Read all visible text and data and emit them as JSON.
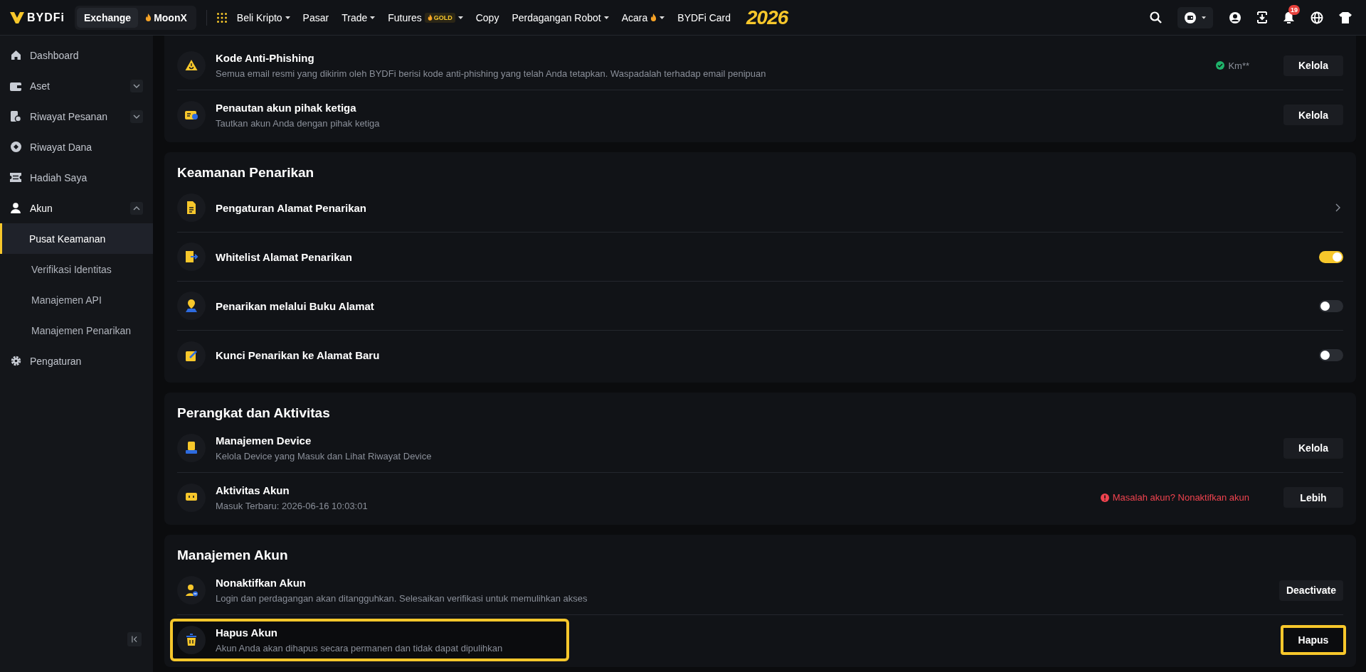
{
  "header": {
    "logo": "BYDFi",
    "modes": [
      {
        "label": "Exchange",
        "selected": true
      },
      {
        "label": "MoonX",
        "selected": false,
        "flame": true
      }
    ],
    "menu": [
      {
        "label": "Beli Kripto",
        "dropdown": true
      },
      {
        "label": "Pasar",
        "dropdown": false
      },
      {
        "label": "Trade",
        "dropdown": true
      },
      {
        "label": "Futures",
        "dropdown": true,
        "badge": "GOLD"
      },
      {
        "label": "Copy",
        "dropdown": false
      },
      {
        "label": "Perdagangan Robot",
        "dropdown": true
      },
      {
        "label": "Acara",
        "dropdown": true,
        "flame": true
      },
      {
        "label": "BYDFi Card",
        "dropdown": false
      }
    ],
    "promo": "2026",
    "notifications": "19"
  },
  "sidebar": {
    "items": [
      {
        "label": "Dashboard",
        "selected": false
      },
      {
        "label": "Aset",
        "selected": false,
        "expanded": false
      },
      {
        "label": "Riwayat Pesanan",
        "selected": false,
        "expanded": false
      },
      {
        "label": "Riwayat Dana",
        "selected": false
      },
      {
        "label": "Hadiah Saya",
        "selected": false
      },
      {
        "label": "Akun",
        "selected": false,
        "expanded": true,
        "children": [
          {
            "label": "Pusat Keamanan",
            "selected": true
          },
          {
            "label": "Verifikasi Identitas",
            "selected": false
          },
          {
            "label": "Manajemen API",
            "selected": false
          },
          {
            "label": "Manajemen Penarikan",
            "selected": false
          }
        ]
      },
      {
        "label": "Pengaturan",
        "selected": false
      }
    ]
  },
  "sections": [
    {
      "rows": [
        {
          "title": "Kode Anti-Phishing",
          "description": "Semua email resmi yang dikirim oleh BYDFi berisi kode anti-phishing yang telah Anda tetapkan. Waspadalah terhadap email penipuan",
          "note": {
            "kind": "verified",
            "text": "Km**"
          },
          "action": {
            "kind": "button",
            "label": "Kelola"
          }
        },
        {
          "title": "Penautan akun pihak ketiga",
          "description": "Tautkan akun Anda dengan pihak ketiga",
          "action": {
            "kind": "button",
            "label": "Kelola"
          }
        }
      ]
    },
    {
      "title": "Keamanan Penarikan",
      "rows": [
        {
          "title": "Pengaturan Alamat Penarikan",
          "action": {
            "kind": "link"
          }
        },
        {
          "title": "Whitelist Alamat Penarikan",
          "action": {
            "kind": "toggle",
            "on": true
          }
        },
        {
          "title": "Penarikan melalui Buku Alamat",
          "action": {
            "kind": "toggle",
            "on": false
          }
        },
        {
          "title": "Kunci Penarikan ke Alamat Baru",
          "action": {
            "kind": "toggle",
            "on": false
          }
        }
      ]
    },
    {
      "title": "Perangkat dan Aktivitas",
      "rows": [
        {
          "title": "Manajemen Device",
          "description": "Kelola Device yang Masuk dan Lihat Riwayat Device",
          "action": {
            "kind": "button",
            "label": "Kelola"
          }
        },
        {
          "title": "Aktivitas Akun",
          "description": "Masuk Terbaru: 2026-06-16 10:03:01",
          "note": {
            "kind": "warning",
            "text": "Masalah akun? Nonaktifkan akun"
          },
          "action": {
            "kind": "button",
            "label": "Lebih"
          }
        }
      ]
    },
    {
      "title": "Manajemen Akun",
      "rows": [
        {
          "title": "Nonaktifkan Akun",
          "description": "Login dan perdagangan akan ditangguhkan. Selesaikan verifikasi untuk memulihkan akses",
          "highlighted": false,
          "action": {
            "kind": "button",
            "label": "Deactivate",
            "highlighted": false
          }
        },
        {
          "title": "Hapus Akun",
          "description": "Akun Anda akan dihapus secara permanen dan tidak dapat dipulihkan",
          "highlighted": true,
          "action": {
            "kind": "button",
            "label": "Hapus",
            "highlighted": true
          }
        }
      ]
    }
  ]
}
